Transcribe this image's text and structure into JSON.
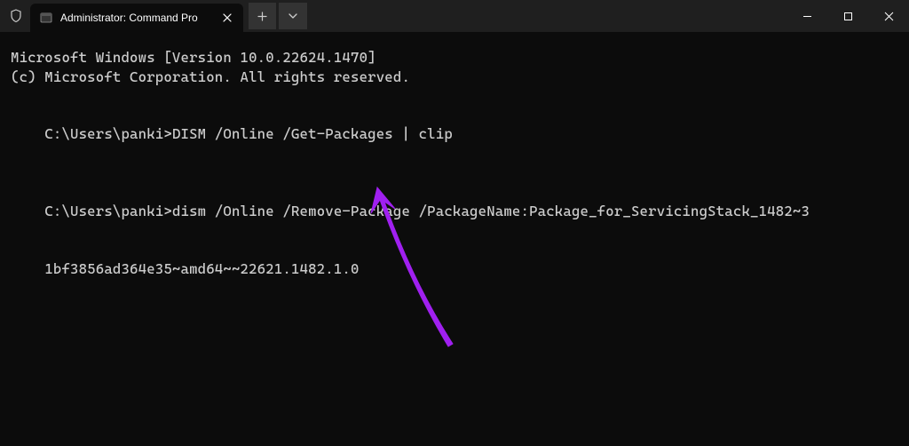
{
  "tab": {
    "title": "Administrator: Command Pro"
  },
  "terminal": {
    "line1": "Microsoft Windows [Version 10.0.22624.1470]",
    "line2": "(c) Microsoft Corporation. All rights reserved.",
    "prompt1": "C:\\Users\\panki>",
    "command1": "DISM /Online /Get-Packages | clip",
    "prompt2": "C:\\Users\\panki>",
    "command2_part1": "dism /Online /Remove-Package /PackageName:Package_for_ServicingStack_1482~3",
    "command2_part2": "1bf3856ad364e35~amd64~~22621.1482.1.0"
  }
}
